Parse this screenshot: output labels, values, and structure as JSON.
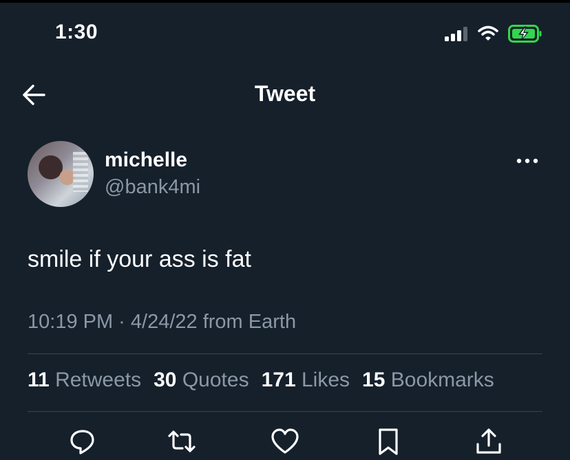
{
  "status_bar": {
    "time": "1:30",
    "icons": [
      "cellular-signal-icon",
      "wifi-icon",
      "battery-charging-icon"
    ],
    "battery_color": "#32d74b"
  },
  "header": {
    "title": "Tweet",
    "back_icon": "arrow-left-icon"
  },
  "author": {
    "name": "michelle",
    "handle": "@bank4mi",
    "more_icon": "more-horizontal-icon"
  },
  "tweet": {
    "text": "smile if your ass is fat",
    "meta": "10:19 PM · 4/24/22 from Earth"
  },
  "stats": [
    {
      "count": "11",
      "label": "Retweets"
    },
    {
      "count": "30",
      "label": "Quotes"
    },
    {
      "count": "171",
      "label": "Likes"
    },
    {
      "count": "15",
      "label": "Bookmarks"
    }
  ],
  "actions": [
    "reply-icon",
    "retweet-icon",
    "like-icon",
    "bookmark-icon",
    "share-icon"
  ],
  "colors": {
    "background": "#15202b",
    "primary_text": "#ffffff",
    "secondary_text": "#8b98a5",
    "divider": "#38444d"
  }
}
